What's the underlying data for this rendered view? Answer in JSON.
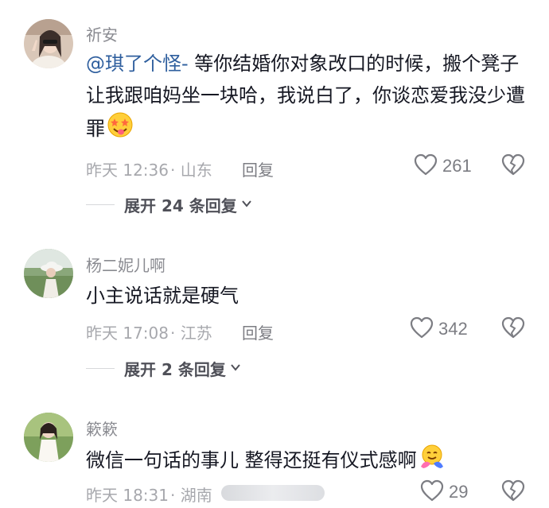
{
  "comments": [
    {
      "username": "祈安",
      "mention": "@琪了个怪-",
      "text": " 等你结婚你对象改口的时候，搬个凳子让我跟咱妈坐一块哈，我说白了，你谈恋爱我没少遭罪",
      "emoji": "star-eyes-tongue-emoji",
      "time": "昨天 12:36",
      "location": "· 山东",
      "reply_label": "回复",
      "likes": "261",
      "expand_label": "展开 24 条回复"
    },
    {
      "username": "杨二妮儿啊",
      "text": "小主说话就是硬气",
      "time": "昨天 17:08",
      "location": "· 江苏",
      "reply_label": "回复",
      "likes": "342",
      "expand_label": "展开 2 条回复"
    },
    {
      "username": "簌簌",
      "text": "微信一句话的事儿 整得还挺有仪式感啊",
      "emoji": "hugging-emoji",
      "time": "昨天 18:31",
      "location": "· 湖南",
      "likes": "29"
    }
  ],
  "icons": {
    "like": "heart-outline-icon",
    "dislike": "broken-heart-icon",
    "expand": "chevron-down-icon"
  },
  "colors": {
    "mention": "#2f5f9e",
    "meta": "#a7a8ad",
    "text": "#161823"
  }
}
